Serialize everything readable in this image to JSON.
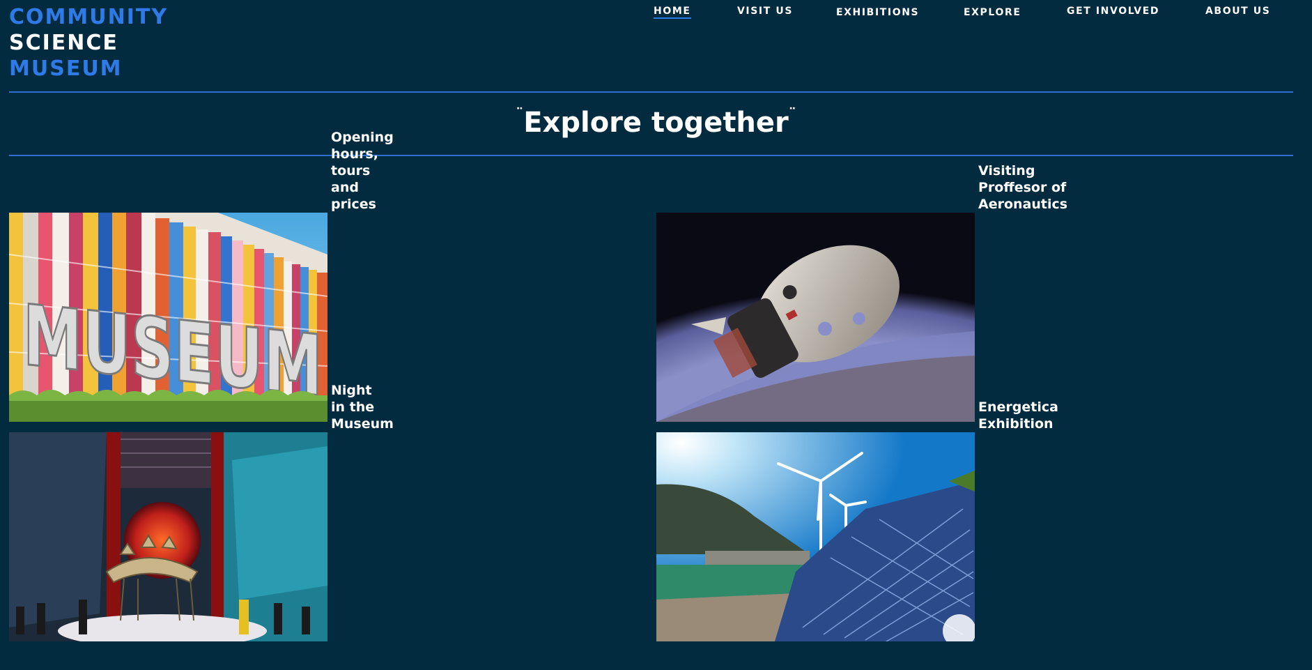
{
  "logo": {
    "line1": "COMMUNITY",
    "line2": "SCIENCE",
    "line3": "MUSEUM"
  },
  "nav": {
    "items": [
      {
        "label": "HOME",
        "active": true
      },
      {
        "label": "VISIT US"
      },
      {
        "label": "EXHIBITIONS"
      },
      {
        "label": "EXPLORE"
      },
      {
        "label": "GET INVOLVED"
      },
      {
        "label": "ABOUT US"
      }
    ]
  },
  "hero": {
    "open_quote": "¨",
    "title": "Explore together",
    "close_quote": "¨"
  },
  "cards": [
    {
      "caption": "Opening\nhours, tours\nand prices"
    },
    {
      "caption": "Visiting\nProffesor of\nAeronautics"
    },
    {
      "caption": "Night\nin the\nMuseum"
    },
    {
      "caption": "Energetica\nExhibition"
    }
  ],
  "colors": {
    "background": "#022b3f",
    "accent": "#2e7ae6",
    "text": "#ffffff"
  }
}
